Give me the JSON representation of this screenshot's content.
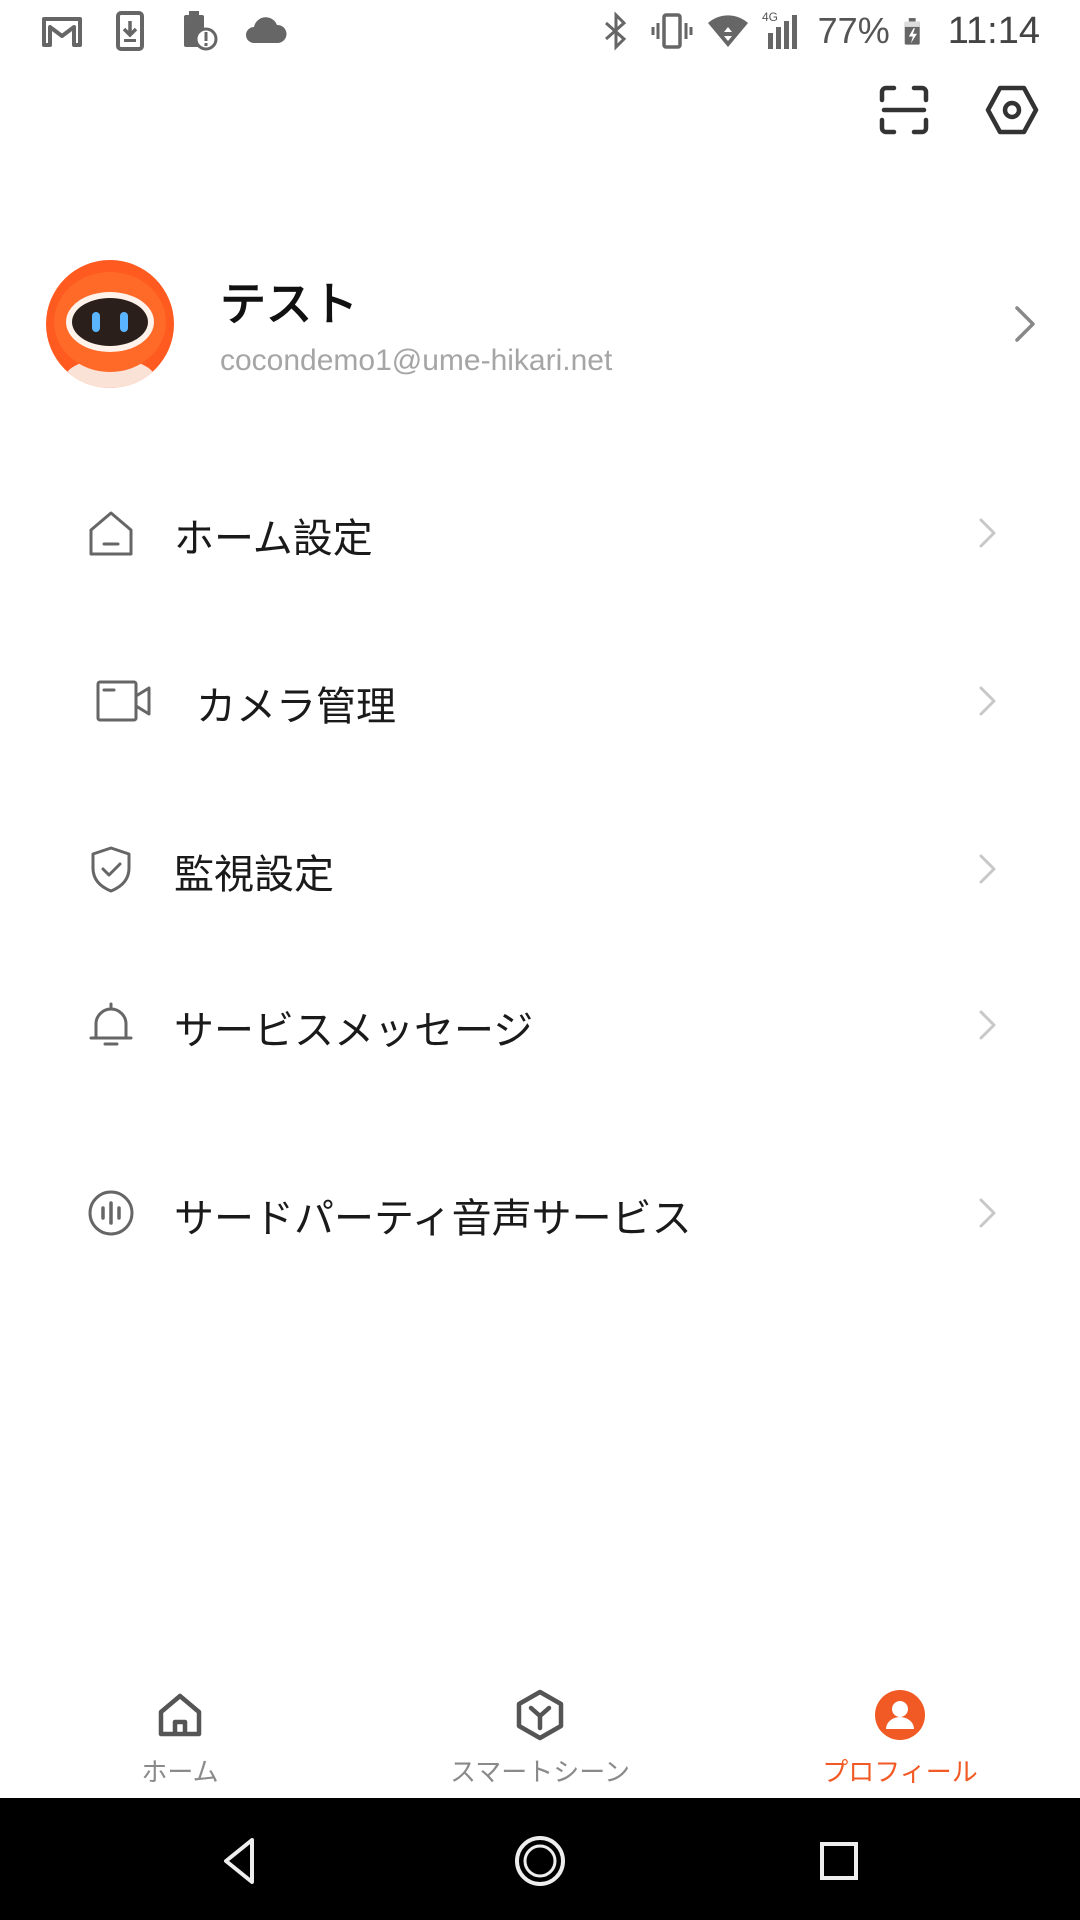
{
  "status_bar": {
    "left_icons": [
      "gmail-icon",
      "download-icon",
      "battery-alert-icon",
      "cloud-icon"
    ],
    "right_icons": [
      "bluetooth-icon",
      "vibrate-icon",
      "wifi-icon",
      "signal-4g-icon",
      "battery-charging-icon"
    ],
    "network_label": "4G",
    "battery_percent": "77%",
    "time": "11:14"
  },
  "top_actions": {
    "icons": [
      "scan-icon",
      "settings-hexagon-icon"
    ]
  },
  "profile": {
    "name": "テスト",
    "email": "cocondemo1@ume-hikari.net",
    "avatar_icon": "robot-avatar-icon"
  },
  "menu": {
    "items": [
      {
        "label": "ホーム設定",
        "icon": "home-outline-icon"
      },
      {
        "label": "カメラ管理",
        "icon": "camera-icon"
      },
      {
        "label": "監視設定",
        "icon": "shield-check-icon"
      },
      {
        "label": "サービスメッセージ",
        "icon": "bell-icon"
      },
      {
        "label": "サードパーティ音声サービス",
        "icon": "voice-icon"
      }
    ]
  },
  "tab_bar": {
    "tabs": [
      {
        "label": "ホーム",
        "icon": "home-icon",
        "active": false
      },
      {
        "label": "スマートシーン",
        "icon": "smart-scene-icon",
        "active": false
      },
      {
        "label": "プロフィール",
        "icon": "profile-icon",
        "active": true
      }
    ]
  },
  "nav_bar": {
    "icons": [
      "back-icon",
      "home-circle-icon",
      "recents-icon"
    ]
  },
  "colors": {
    "accent": "#f15a24",
    "icon_gray": "#666666",
    "chevron_gray": "#c8c8c8",
    "email_gray": "#a5a5a5",
    "tab_inactive": "#8a8a8a",
    "nav_background": "#000000"
  }
}
